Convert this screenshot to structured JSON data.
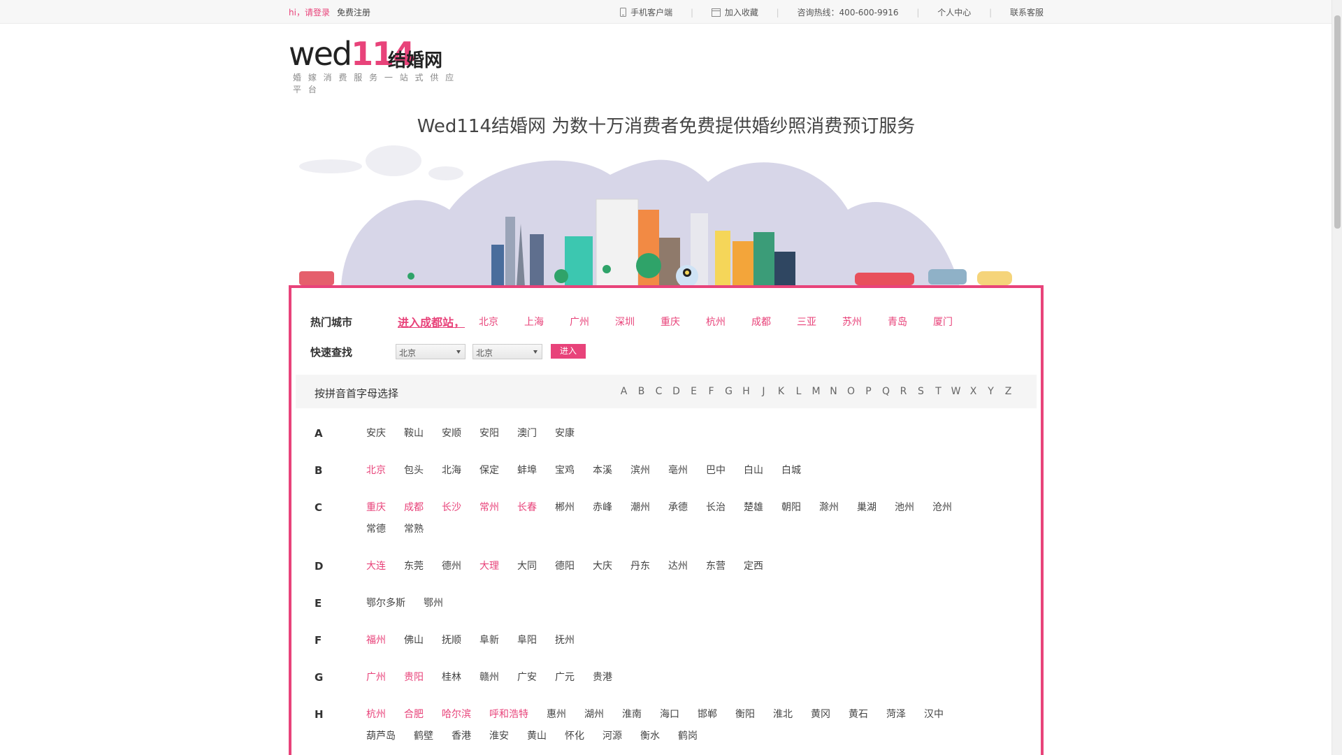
{
  "topbar": {
    "greeting": "hi，",
    "login": "请登录",
    "register": "免费注册",
    "mobile_client": "手机客户端",
    "bookmark": "加入收藏",
    "hotline": "咨询热线：400-600-9916",
    "user_center": "个人中心",
    "contact": "联系客服"
  },
  "logo": {
    "wed": "wed",
    "num": "114",
    "cn": "结婚网",
    "tagline": "婚 嫁 消 费 服 务 一 站 式 供 应 平 台"
  },
  "headline": "Wed114结婚网 为数十万消费者免费提供婚纱照消费预订服务",
  "hot": {
    "label": "热门城市",
    "enter": "进入成都站，",
    "cities": [
      "北京",
      "上海",
      "广州",
      "深圳",
      "重庆",
      "杭州",
      "成都",
      "三亚",
      "苏州",
      "青岛",
      "厦门"
    ]
  },
  "quick": {
    "label": "快速查找",
    "province": "北京",
    "city": "北京",
    "button": "进入"
  },
  "alpha": {
    "title": "按拼音首字母选择",
    "letters": [
      "A",
      "B",
      "C",
      "D",
      "E",
      "F",
      "G",
      "H",
      "J",
      "K",
      "L",
      "M",
      "N",
      "O",
      "P",
      "Q",
      "R",
      "S",
      "T",
      "W",
      "X",
      "Y",
      "Z"
    ]
  },
  "groups": [
    {
      "letter": "A",
      "lines": [
        [
          [
            "安庆",
            0
          ],
          [
            "鞍山",
            0
          ],
          [
            "安顺",
            0
          ],
          [
            "安阳",
            0
          ],
          [
            "澳门",
            0
          ],
          [
            "安康",
            0
          ]
        ]
      ]
    },
    {
      "letter": "B",
      "lines": [
        [
          [
            "北京",
            1
          ],
          [
            "包头",
            0
          ],
          [
            "北海",
            0
          ],
          [
            "保定",
            0
          ],
          [
            "蚌埠",
            0
          ],
          [
            "宝鸡",
            0
          ],
          [
            "本溪",
            0
          ],
          [
            "滨州",
            0
          ],
          [
            "亳州",
            0
          ],
          [
            "巴中",
            0
          ],
          [
            "白山",
            0
          ],
          [
            "白城",
            0
          ]
        ]
      ]
    },
    {
      "letter": "C",
      "lines": [
        [
          [
            "重庆",
            1
          ],
          [
            "成都",
            1
          ],
          [
            "长沙",
            1
          ],
          [
            "常州",
            1
          ],
          [
            "长春",
            1
          ],
          [
            "郴州",
            0
          ],
          [
            "赤峰",
            0
          ],
          [
            "潮州",
            0
          ],
          [
            "承德",
            0
          ],
          [
            "长治",
            0
          ],
          [
            "楚雄",
            0
          ],
          [
            "朝阳",
            0
          ],
          [
            "滁州",
            0
          ],
          [
            "巢湖",
            0
          ],
          [
            "池州",
            0
          ],
          [
            "沧州",
            0
          ]
        ],
        [
          [
            "常德",
            0
          ],
          [
            "常熟",
            0
          ]
        ]
      ]
    },
    {
      "letter": "D",
      "lines": [
        [
          [
            "大连",
            1
          ],
          [
            "东莞",
            0
          ],
          [
            "德州",
            0
          ],
          [
            "大理",
            1
          ],
          [
            "大同",
            0
          ],
          [
            "德阳",
            0
          ],
          [
            "大庆",
            0
          ],
          [
            "丹东",
            0
          ],
          [
            "达州",
            0
          ],
          [
            "东营",
            0
          ],
          [
            "定西",
            0
          ]
        ]
      ]
    },
    {
      "letter": "E",
      "lines": [
        [
          [
            "鄂尔多斯",
            0
          ],
          [
            "鄂州",
            0
          ]
        ]
      ]
    },
    {
      "letter": "F",
      "lines": [
        [
          [
            "福州",
            1
          ],
          [
            "佛山",
            0
          ],
          [
            "抚顺",
            0
          ],
          [
            "阜新",
            0
          ],
          [
            "阜阳",
            0
          ],
          [
            "抚州",
            0
          ]
        ]
      ]
    },
    {
      "letter": "G",
      "lines": [
        [
          [
            "广州",
            1
          ],
          [
            "贵阳",
            1
          ],
          [
            "桂林",
            0
          ],
          [
            "赣州",
            0
          ],
          [
            "广安",
            0
          ],
          [
            "广元",
            0
          ],
          [
            "贵港",
            0
          ]
        ]
      ]
    },
    {
      "letter": "H",
      "lines": [
        [
          [
            "杭州",
            1
          ],
          [
            "合肥",
            1
          ],
          [
            "哈尔滨",
            1
          ],
          [
            "呼和浩特",
            1
          ],
          [
            "惠州",
            0
          ],
          [
            "湖州",
            0
          ],
          [
            "淮南",
            0
          ],
          [
            "海口",
            0
          ],
          [
            "邯郸",
            0
          ],
          [
            "衡阳",
            0
          ],
          [
            "淮北",
            0
          ],
          [
            "黄冈",
            0
          ],
          [
            "黄石",
            0
          ],
          [
            "菏泽",
            0
          ],
          [
            "汉中",
            0
          ]
        ],
        [
          [
            "葫芦岛",
            0
          ],
          [
            "鹤壁",
            0
          ],
          [
            "香港",
            0
          ],
          [
            "淮安",
            0
          ],
          [
            "黄山",
            0
          ],
          [
            "怀化",
            0
          ],
          [
            "河源",
            0
          ],
          [
            "衡水",
            0
          ],
          [
            "鹤岗",
            0
          ]
        ]
      ]
    }
  ]
}
